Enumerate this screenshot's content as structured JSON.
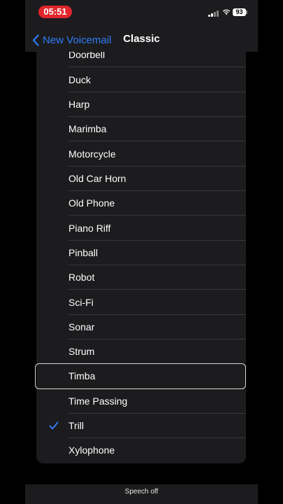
{
  "status_bar": {
    "time": "05:51",
    "battery": "93"
  },
  "nav": {
    "back_label": "New Voicemail",
    "title": "Classic"
  },
  "list": {
    "items": [
      {
        "label": "Doorbell",
        "selected": false
      },
      {
        "label": "Duck",
        "selected": false
      },
      {
        "label": "Harp",
        "selected": false
      },
      {
        "label": "Marimba",
        "selected": false
      },
      {
        "label": "Motorcycle",
        "selected": false
      },
      {
        "label": "Old Car Horn",
        "selected": false
      },
      {
        "label": "Old Phone",
        "selected": false
      },
      {
        "label": "Piano Riff",
        "selected": false
      },
      {
        "label": "Pinball",
        "selected": false
      },
      {
        "label": "Robot",
        "selected": false
      },
      {
        "label": "Sci-Fi",
        "selected": false
      },
      {
        "label": "Sonar",
        "selected": false
      },
      {
        "label": "Strum",
        "selected": false
      },
      {
        "label": "Timba",
        "selected": false,
        "focused": true
      },
      {
        "label": "Time Passing",
        "selected": false
      },
      {
        "label": "Trill",
        "selected": true
      },
      {
        "label": "Xylophone",
        "selected": false
      }
    ]
  },
  "footer": {
    "caption": "Speech off"
  },
  "colors": {
    "accent": "#2f7cf6",
    "record_pill": "#e0262d",
    "cell_bg": "#1c1c1e"
  }
}
